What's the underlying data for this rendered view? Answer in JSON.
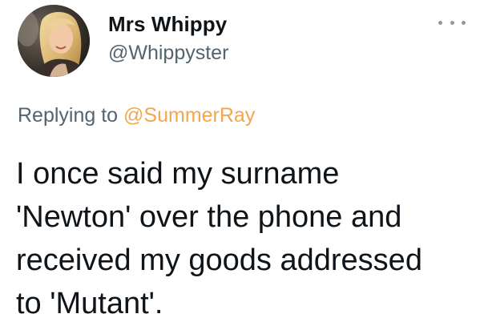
{
  "author": {
    "display_name": "Mrs Whippy",
    "handle": "@Whippyster",
    "avatar_icon": "profile-photo"
  },
  "more_icon": "more-horizontal-icon",
  "reply": {
    "prefix": "Replying to",
    "mention": "@SummerRay",
    "mention_color": "#f4a64c"
  },
  "tweet": {
    "lines": [
      "I once said my surname",
      "'Newton' over the phone and",
      "received my goods addressed",
      "to 'Mutant'."
    ]
  },
  "colors": {
    "text": "#0f1419",
    "secondary": "#536471",
    "background": "#ffffff"
  }
}
